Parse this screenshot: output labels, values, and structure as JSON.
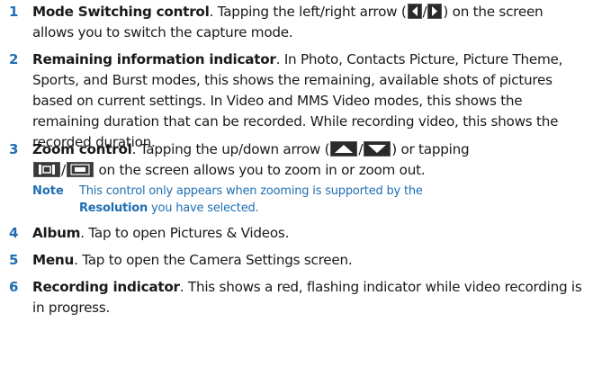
{
  "accent_color": "#1f6fb2",
  "items": [
    {
      "number": "1",
      "title": "Mode Switching control",
      "text_a": ". Tapping the left/right arrow (",
      "sep": "/",
      "text_b": ") on the screen allows you to switch the capture mode."
    },
    {
      "number": "2",
      "title": "Remaining information indicator",
      "text": ". In Photo, Contacts Picture, Picture Theme, Sports, and Burst modes, this shows the remaining, available shots of pictures based on current settings. In Video and MMS Video modes, this shows the remaining duration that can be recorded. While recording video, this shows the recorded duration."
    },
    {
      "number": "3",
      "title": "Zoom control",
      "text_a": ". Tapping the up/down arrow (",
      "sep": "/",
      "text_b": ") or tapping",
      "sep2": "/",
      "text_c": "on the screen allows you to zoom in or zoom out.",
      "note_label": "Note",
      "note_a": "This control only appears when zooming is supported by the",
      "note_bold": "Resolution",
      "note_b": "you have selected."
    },
    {
      "number": "4",
      "title": "Album",
      "text": ". Tap to open Pictures & Videos."
    },
    {
      "number": "5",
      "title": "Menu",
      "text": ". Tap to open the Camera Settings screen."
    },
    {
      "number": "6",
      "title": "Recording indicator",
      "text": ". This shows a red, flashing indicator while video recording is in progress."
    }
  ],
  "icons": [
    "left-arrow-icon",
    "right-arrow-icon",
    "up-arrow-icon",
    "down-arrow-icon",
    "zoom-out-icon",
    "zoom-in-icon"
  ]
}
